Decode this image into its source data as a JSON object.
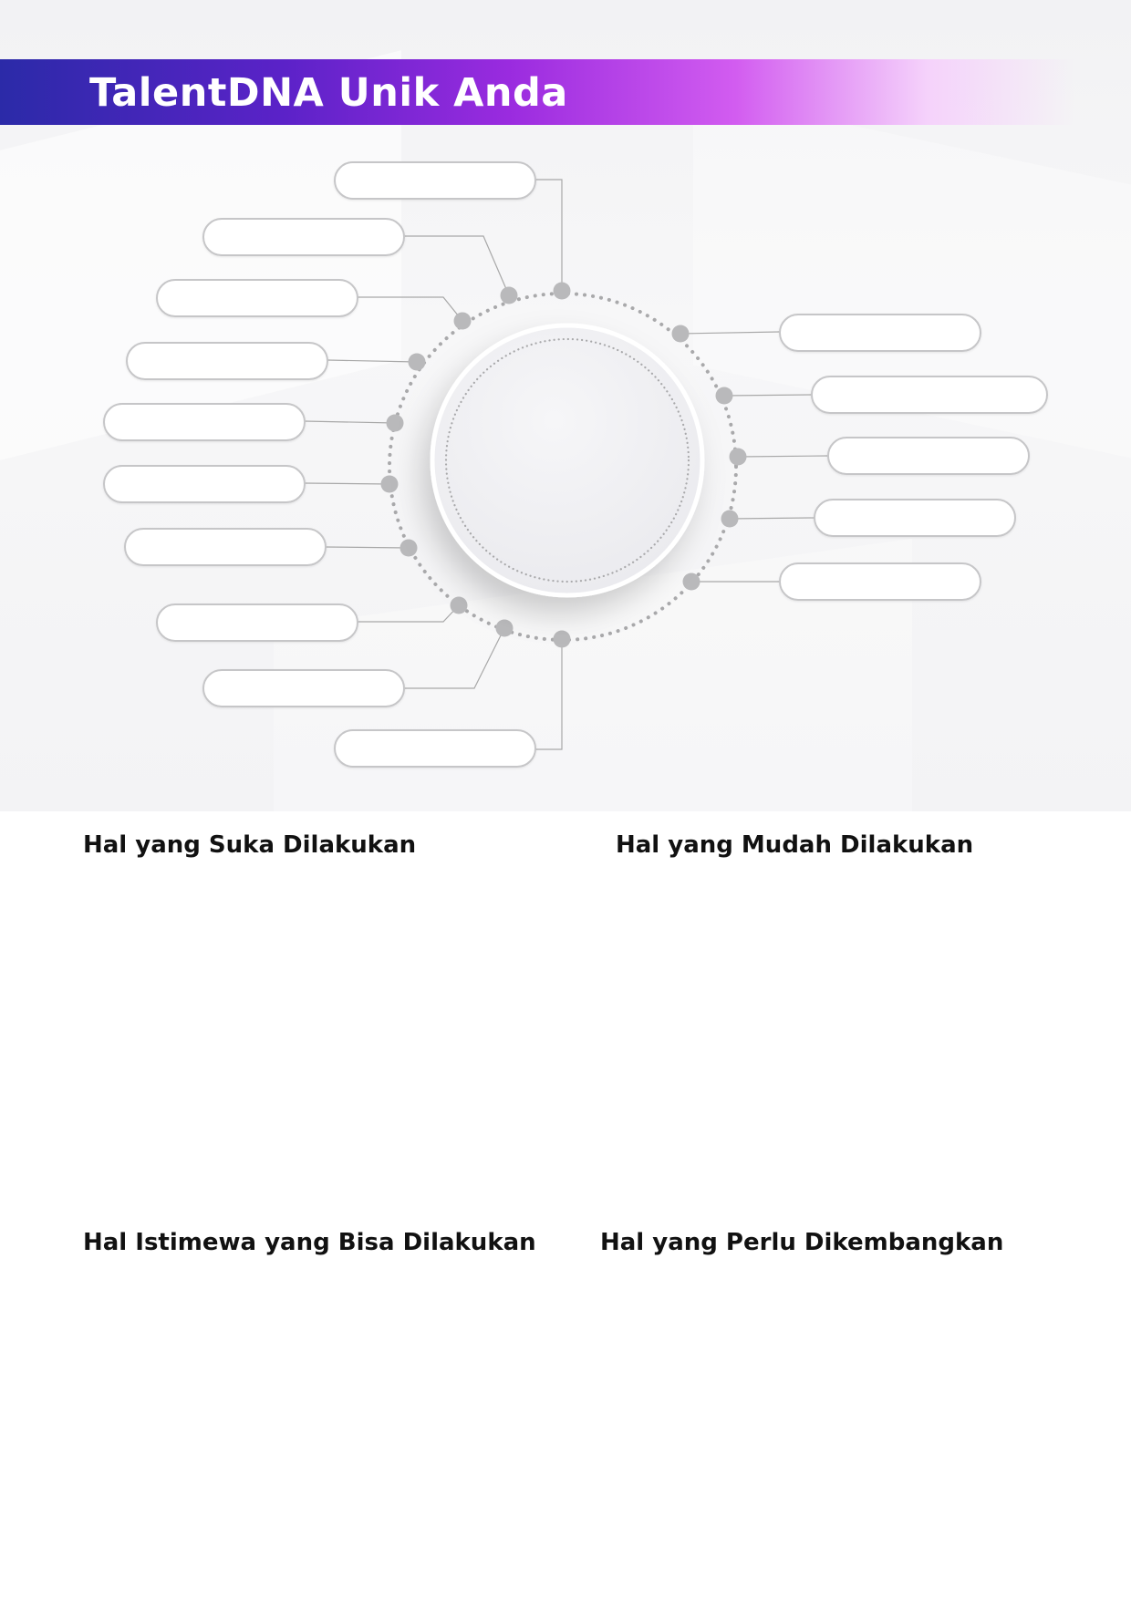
{
  "header": {
    "title": "TalentDNA Unik Anda",
    "gradient_colors": [
      "#2b2aa8",
      "#9a2bdf",
      "#f5d2fb"
    ]
  },
  "diagram": {
    "left_labels": [
      "",
      "",
      "",
      "",
      "",
      "",
      "",
      "",
      "",
      ""
    ],
    "right_labels": [
      "",
      "",
      "",
      "",
      ""
    ],
    "center_label": "",
    "connector_color": "#a8a8a8",
    "dot_color": "#b9b9bb"
  },
  "sections": {
    "likes": {
      "title": "Hal yang Suka Dilakukan",
      "content": ""
    },
    "easy": {
      "title": "Hal yang Mudah Dilakukan",
      "content": ""
    },
    "special": {
      "title": "Hal Istimewa yang Bisa Dilakukan",
      "content": ""
    },
    "develop": {
      "title": "Hal yang Perlu Dikembangkan",
      "content": ""
    }
  }
}
